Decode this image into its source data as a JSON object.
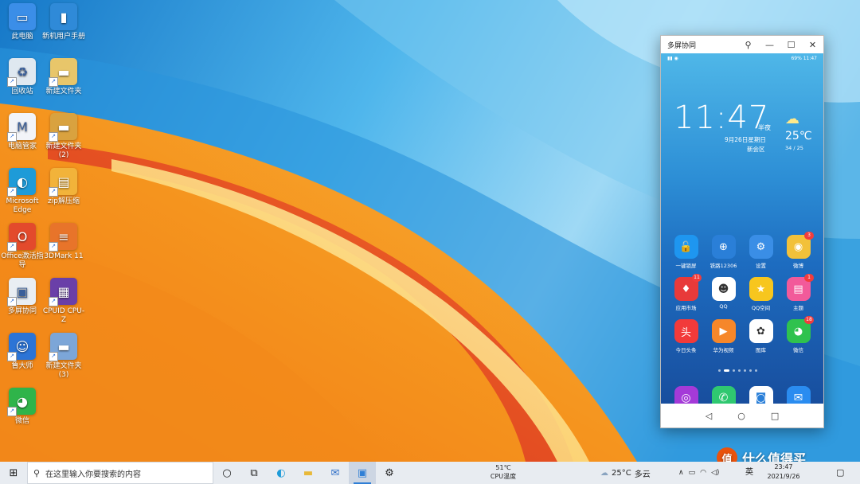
{
  "desktop": {
    "icons": [
      {
        "label": "此电脑",
        "icon": "computer-icon",
        "color": "#3b8ee8"
      },
      {
        "label": "新机用户手册",
        "icon": "book-icon",
        "color": "#2f8ad8"
      },
      {
        "label": "回收站",
        "icon": "recycle-bin-icon",
        "color": "#dfe8f0"
      },
      {
        "label": "新建文件夹",
        "icon": "folder-icon",
        "color": "#e8c66a"
      },
      {
        "label": "电脑管家",
        "icon": "pc-manager-icon",
        "color": "#f2f4f8"
      },
      {
        "label": "新建文件夹(2)",
        "icon": "folder-icon",
        "color": "#d9a23f"
      },
      {
        "label": "Microsoft Edge",
        "icon": "edge-icon",
        "color": "#1e9bd8"
      },
      {
        "label": "zip解压缩",
        "icon": "zip-icon",
        "color": "#f2b33a"
      },
      {
        "label": "Office激活指导",
        "icon": "office-icon",
        "color": "#e34a2c"
      },
      {
        "label": "3DMark 11",
        "icon": "3dmark-icon",
        "color": "#e8742a"
      },
      {
        "label": "多屏协同",
        "icon": "multiscreen-icon",
        "color": "#e9eef3"
      },
      {
        "label": "CPUID CPU-Z",
        "icon": "cpuz-icon",
        "color": "#6a3fa8"
      },
      {
        "label": "鲁大师",
        "icon": "ludashi-icon",
        "color": "#2c74d6"
      },
      {
        "label": "新建文件夹(3)",
        "icon": "folder-icon",
        "color": "#7ca6d8"
      },
      {
        "label": "微信",
        "icon": "wechat-icon",
        "color": "#2fb44a"
      }
    ]
  },
  "phone_window": {
    "title": "多屏协同",
    "status_right": "69% 11:47",
    "clock": "11:47",
    "ampm": "半夜",
    "date": "9月26日星期日",
    "location": "新会区",
    "temp": "25℃",
    "range": "34 / 25",
    "apps": [
      {
        "label": "一键锁屏",
        "icon": "lock-icon",
        "color": "#1e96f0",
        "badge": ""
      },
      {
        "label": "铁路12306",
        "icon": "railway-icon",
        "color": "#2a7fd8",
        "badge": ""
      },
      {
        "label": "设置",
        "icon": "settings-icon",
        "color": "#3a8ee6",
        "badge": ""
      },
      {
        "label": "微博",
        "icon": "weibo-icon",
        "color": "#f2c13a",
        "badge": "3"
      },
      {
        "label": "应用市场",
        "icon": "appmarket-icon",
        "color": "#e83a3a",
        "badge": "11"
      },
      {
        "label": "QQ",
        "icon": "qq-icon",
        "color": "#ffffff",
        "badge": ""
      },
      {
        "label": "QQ空间",
        "icon": "qzone-icon",
        "color": "#f7c61e",
        "badge": ""
      },
      {
        "label": "主题",
        "icon": "theme-icon",
        "color": "#f25a9a",
        "badge": "1"
      },
      {
        "label": "今日头条",
        "icon": "toutiao-icon",
        "color": "#f23a3a",
        "badge": ""
      },
      {
        "label": "华为视频",
        "icon": "video-icon",
        "color": "#f6872a",
        "badge": ""
      },
      {
        "label": "图库",
        "icon": "gallery-icon",
        "color": "#ffffff",
        "badge": ""
      },
      {
        "label": "微信",
        "icon": "wechat-icon",
        "color": "#2fc24e",
        "badge": "18"
      }
    ],
    "dock": [
      {
        "icon": "browser-icon",
        "color": "#a43ad8"
      },
      {
        "icon": "phone-icon",
        "color": "#2fc870"
      },
      {
        "icon": "camera-icon",
        "color": "#ffffff"
      },
      {
        "icon": "messages-icon",
        "color": "#2a8cf0"
      }
    ]
  },
  "taskbar": {
    "search_placeholder": "在这里输入你要搜索的内容",
    "cpu_temp": "51℃",
    "cpu_label": "CPU温度",
    "weather_temp": "25°C",
    "weather_desc": "多云",
    "ime": "英",
    "time": "23:47",
    "date": "2021/9/26"
  },
  "watermark": "什么值得买"
}
